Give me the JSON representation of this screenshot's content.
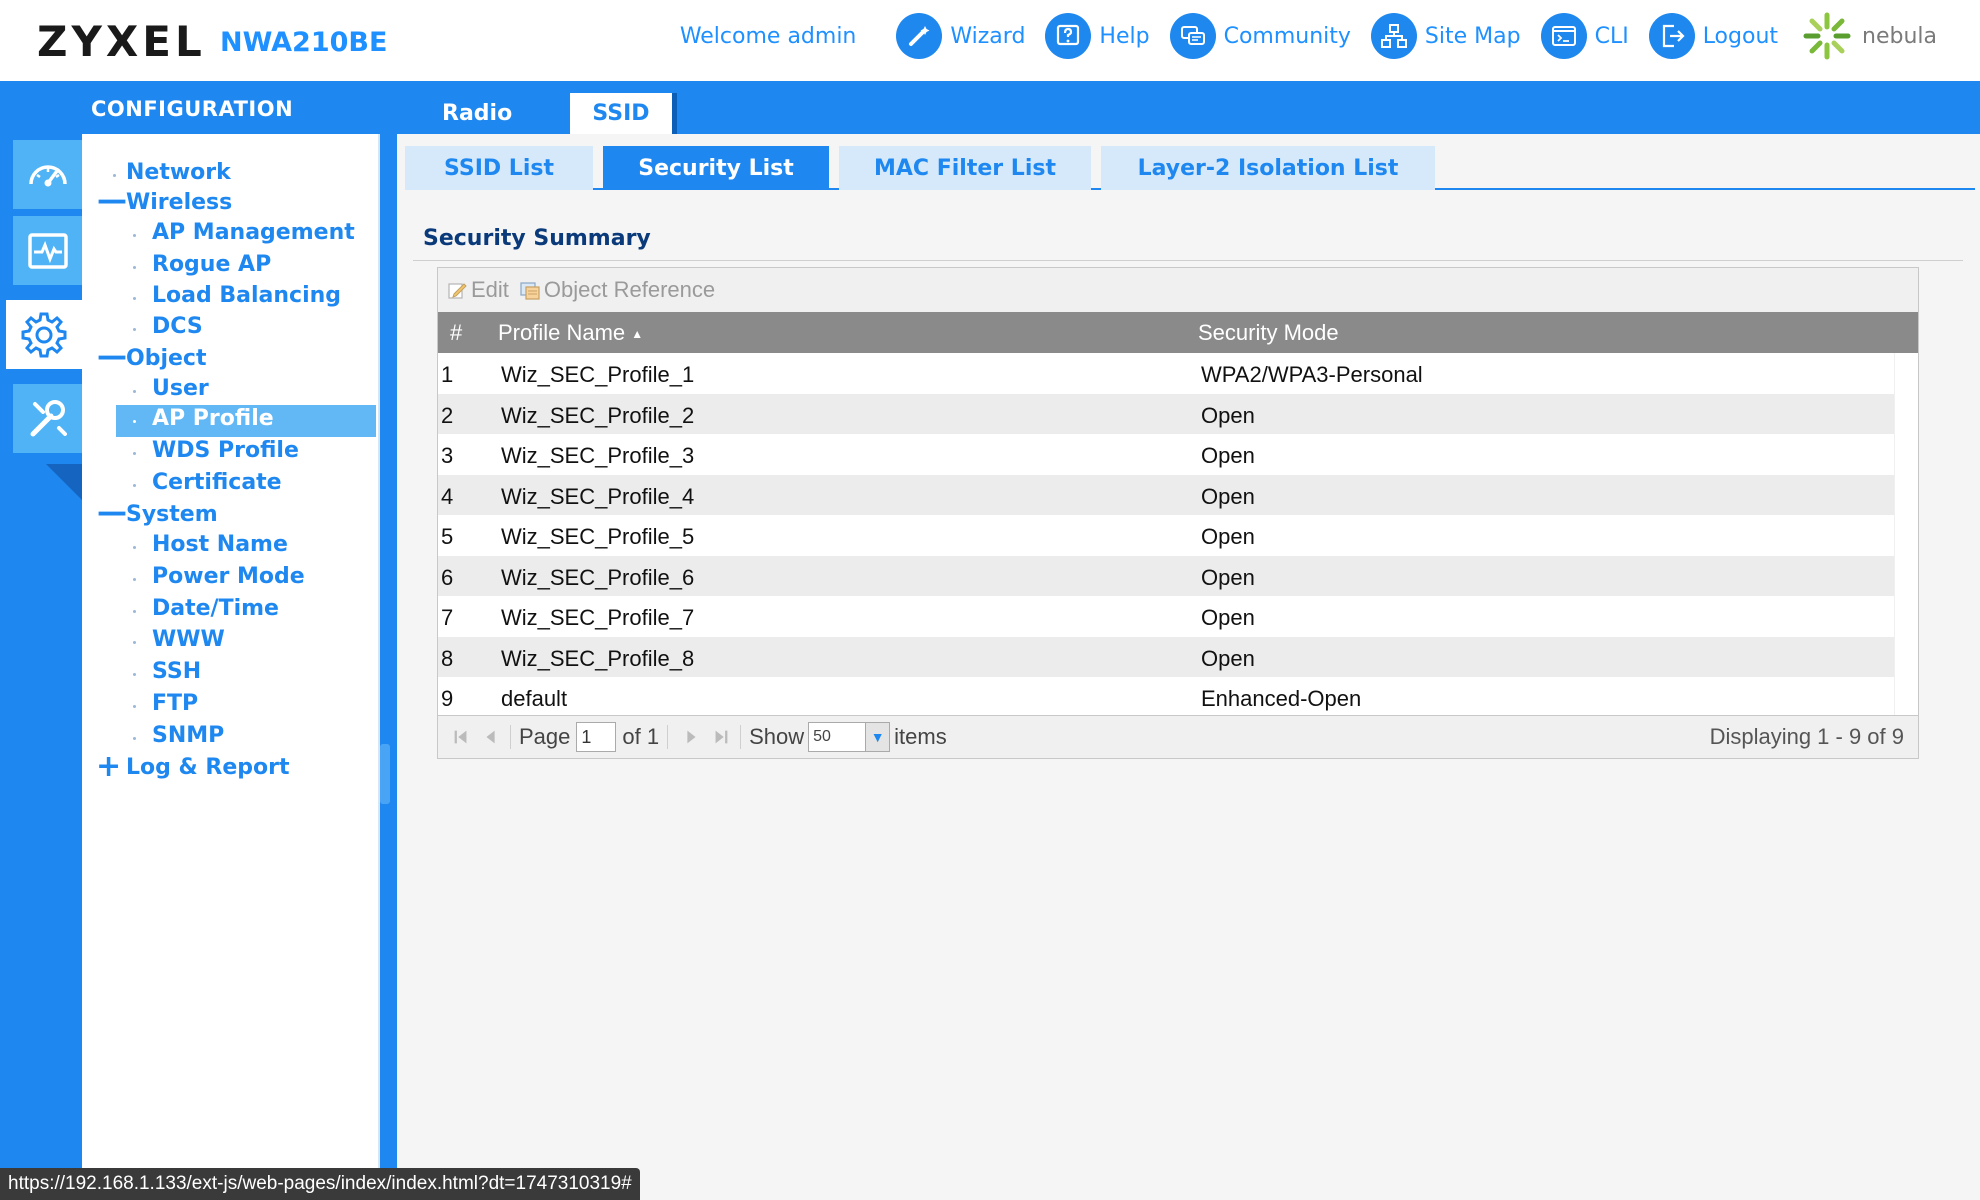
{
  "header": {
    "brand": "ZYXEL",
    "model": "NWA210BE",
    "welcome": "Welcome admin",
    "links": [
      {
        "label": "Wizard",
        "icon": "wizard-icon"
      },
      {
        "label": "Help",
        "icon": "help-icon"
      },
      {
        "label": "Community",
        "icon": "community-icon"
      },
      {
        "label": "Site Map",
        "icon": "site-map-icon"
      },
      {
        "label": "CLI",
        "icon": "cli-icon"
      },
      {
        "label": "Logout",
        "icon": "logout-icon"
      }
    ],
    "nebula": "nebula"
  },
  "band": {
    "title": "CONFIGURATION",
    "tabs": [
      {
        "label": "Radio",
        "active": false
      },
      {
        "label": "SSID",
        "active": true
      }
    ]
  },
  "rail": {
    "items": [
      {
        "icon": "dashboard-icon",
        "active": false
      },
      {
        "icon": "monitor-icon",
        "active": false
      },
      {
        "icon": "gear-icon",
        "active": true
      },
      {
        "icon": "maintenance-icon",
        "active": false
      }
    ]
  },
  "nav": {
    "network": "Network",
    "wireless": "Wireless",
    "ap_management": "AP Management",
    "rogue_ap": "Rogue AP",
    "load_balancing": "Load Balancing",
    "dcs": "DCS",
    "object": "Object",
    "user": "User",
    "ap_profile": "AP Profile",
    "wds_profile": "WDS Profile",
    "certificate": "Certificate",
    "system": "System",
    "host_name": "Host Name",
    "power_mode": "Power Mode",
    "date_time": "Date/Time",
    "www": "WWW",
    "ssh": "SSH",
    "ftp": "FTP",
    "snmp": "SNMP",
    "log_report": "Log & Report",
    "selected": "AP Profile"
  },
  "subtabs": [
    {
      "label": "SSID List",
      "active": false
    },
    {
      "label": "Security List",
      "active": true
    },
    {
      "label": "MAC Filter List",
      "active": false
    },
    {
      "label": "Layer-2 Isolation List",
      "active": false
    }
  ],
  "section": {
    "title": "Security Summary"
  },
  "toolbar": {
    "edit": "Edit",
    "object_reference": "Object Reference"
  },
  "table": {
    "columns": {
      "num": "#",
      "name": "Profile Name",
      "mode": "Security Mode"
    },
    "sorted_by": "Profile Name",
    "rows": [
      {
        "num": "1",
        "name": "Wiz_SEC_Profile_1",
        "mode": "WPA2/WPA3-Personal"
      },
      {
        "num": "2",
        "name": "Wiz_SEC_Profile_2",
        "mode": "Open"
      },
      {
        "num": "3",
        "name": "Wiz_SEC_Profile_3",
        "mode": "Open"
      },
      {
        "num": "4",
        "name": "Wiz_SEC_Profile_4",
        "mode": "Open"
      },
      {
        "num": "5",
        "name": "Wiz_SEC_Profile_5",
        "mode": "Open"
      },
      {
        "num": "6",
        "name": "Wiz_SEC_Profile_6",
        "mode": "Open"
      },
      {
        "num": "7",
        "name": "Wiz_SEC_Profile_7",
        "mode": "Open"
      },
      {
        "num": "8",
        "name": "Wiz_SEC_Profile_8",
        "mode": "Open"
      },
      {
        "num": "9",
        "name": "default",
        "mode": "Enhanced-Open"
      }
    ]
  },
  "pager": {
    "page_label": "Page",
    "page_value": "1",
    "of_label": "of 1",
    "show_label": "Show",
    "show_value": "50",
    "items_label": "items",
    "display": "Displaying 1 - 9 of 9"
  },
  "statusbar": {
    "url": "https://192.168.1.133/ext-js/web-pages/index/index.html?dt=1747310319#"
  },
  "colors": {
    "accent": "#1e88f0",
    "nav_selected": "#62b8f5",
    "header_text": "#1e90ff",
    "table_header": "#8a8a8a"
  }
}
